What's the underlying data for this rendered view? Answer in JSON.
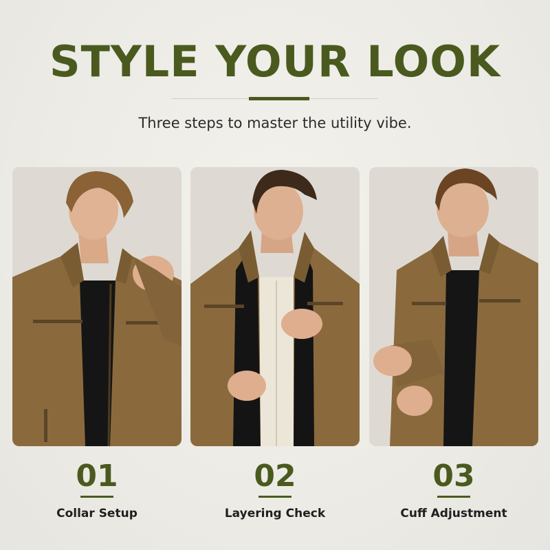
{
  "header": {
    "title": "STYLE YOUR LOOK",
    "subtitle": "Three steps to master the utility vibe."
  },
  "steps": [
    {
      "number": "01",
      "label": "Collar Setup",
      "image": "man adjusting jacket collar"
    },
    {
      "number": "02",
      "label": "Layering Check",
      "image": "man layering jacket over shirt"
    },
    {
      "number": "03",
      "label": "Cuff Adjustment",
      "image": "man adjusting jacket cuff"
    }
  ],
  "colors": {
    "accent": "#4a5a1f",
    "background": "#efede8",
    "jacket": "#8a6a3d",
    "text": "#1f1f1f"
  }
}
